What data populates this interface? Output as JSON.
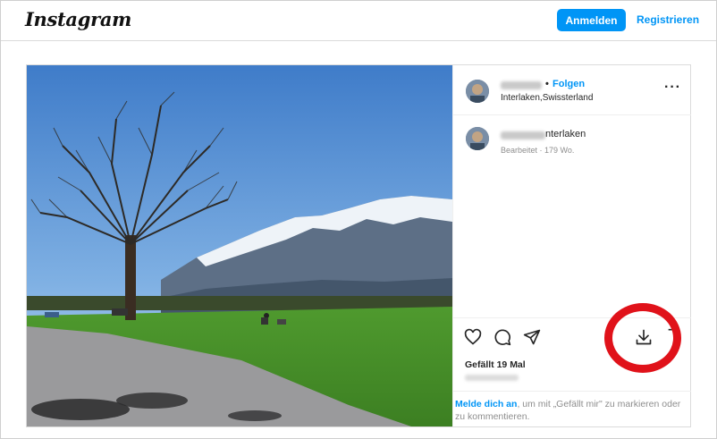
{
  "header": {
    "logo": "Instagram",
    "login_label": "Anmelden",
    "register_label": "Registrieren"
  },
  "post": {
    "separator": "•",
    "follow_label": "Folgen",
    "location": "Interlaken,Swissterland",
    "more_label": "···",
    "caption_text": "nterlaken",
    "edited_label": "Bearbeitet · 179 Wo.",
    "likes": "Gefällt 19 Mal",
    "login_link": "Melde dich an",
    "login_rest": ", um mit „Gefällt mir\" zu markieren oder zu kommentieren."
  },
  "icons": {
    "like": "heart-icon",
    "comment": "comment-icon",
    "share": "share-icon",
    "download": "download-icon",
    "save": "bookmark-icon"
  },
  "colors": {
    "accent": "#0095f6",
    "highlight": "#e0121a"
  }
}
